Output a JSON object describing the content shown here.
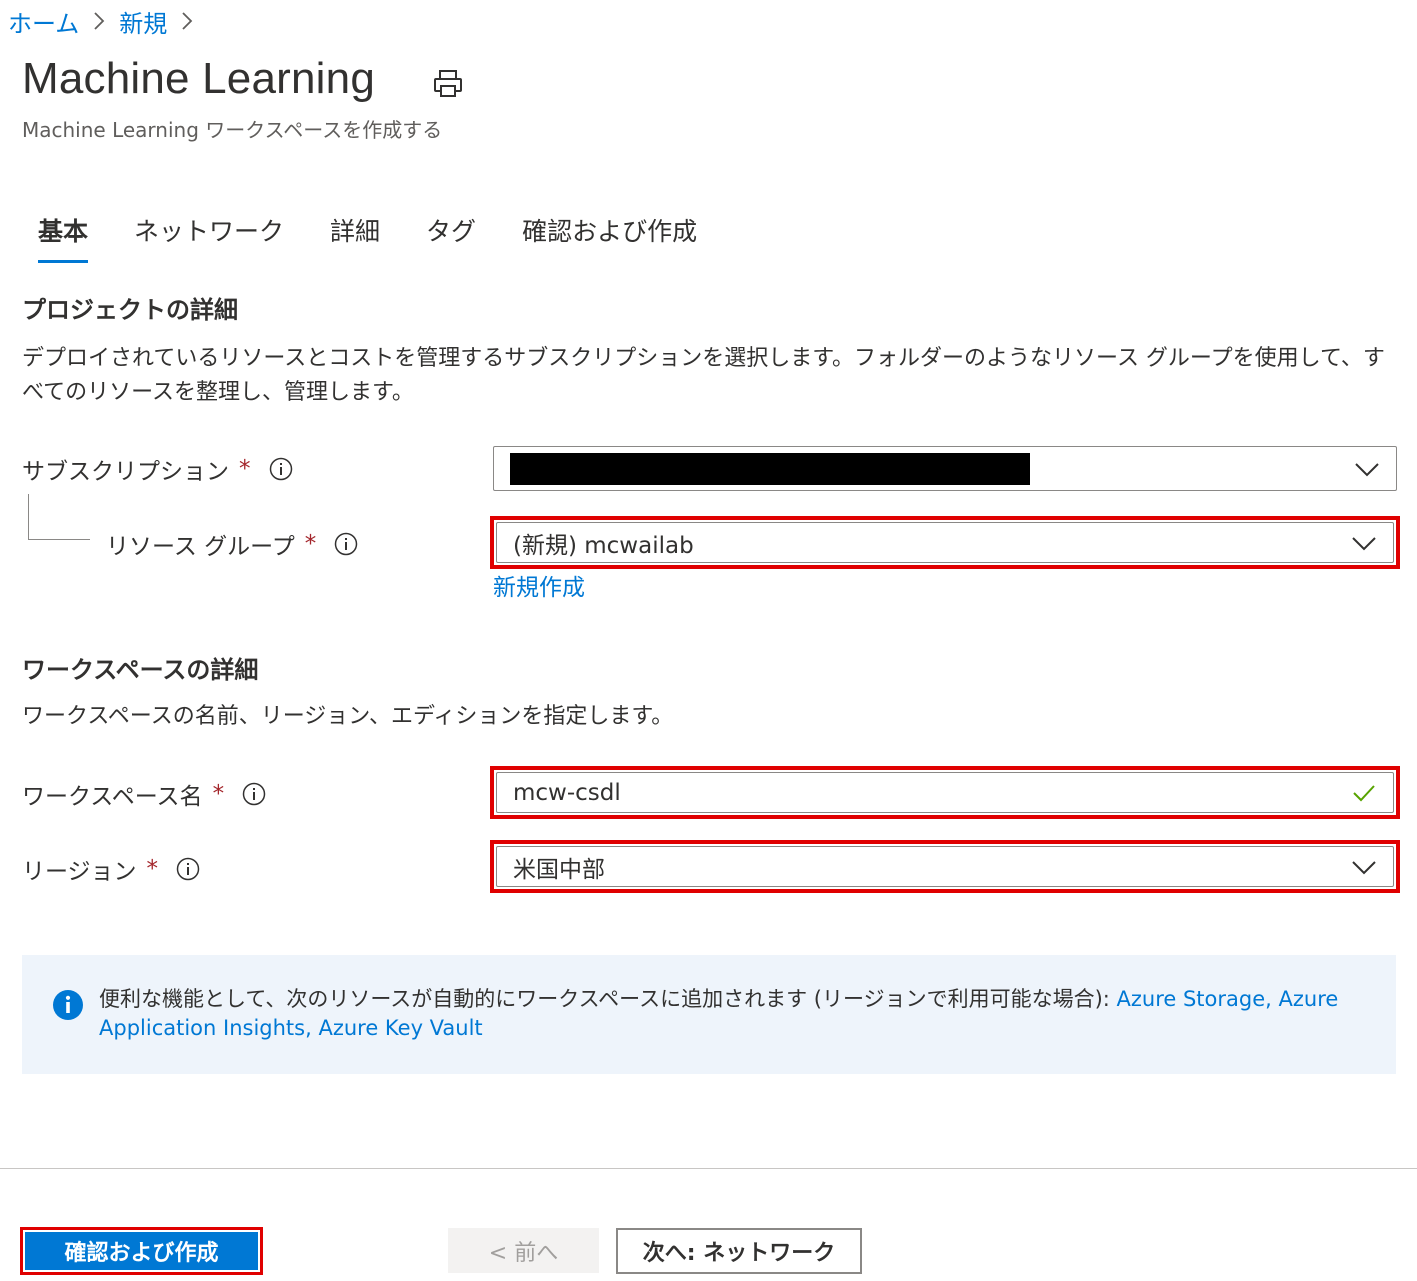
{
  "breadcrumb": {
    "items": [
      "ホーム",
      "新規"
    ]
  },
  "header": {
    "title": "Machine Learning",
    "subtitle": "Machine Learning ワークスペースを作成する",
    "print_icon": "print-icon"
  },
  "tabs": [
    {
      "label": "基本",
      "active": true
    },
    {
      "label": "ネットワーク",
      "active": false
    },
    {
      "label": "詳細",
      "active": false
    },
    {
      "label": "タグ",
      "active": false
    },
    {
      "label": "確認および作成",
      "active": false
    }
  ],
  "project": {
    "heading": "プロジェクトの詳細",
    "description": "デプロイされているリソースとコストを管理するサブスクリプションを選択します。フォルダーのようなリソース グループを使用して、すべてのリソースを整理し、管理します。",
    "subscription_label": "サブスクリプション",
    "subscription_value": "",
    "resource_group_label": "リソース グループ",
    "resource_group_value": "(新規) mcwailab",
    "create_new_link": "新規作成",
    "required_mark": "*"
  },
  "workspace": {
    "heading": "ワークスペースの詳細",
    "description": "ワークスペースの名前、リージョン、エディションを指定します。",
    "name_label": "ワークスペース名",
    "name_value": "mcw-csdl",
    "region_label": "リージョン",
    "region_value": "米国中部",
    "required_mark": "*"
  },
  "info": {
    "text": "便利な機能として、次のリソースが自動的にワークスペースに追加されます (リージョンで利用可能な場合): ",
    "links": "Azure Storage, Azure Application Insights, Azure Key Vault"
  },
  "footer": {
    "review_create": "確認および作成",
    "previous": "< 前へ",
    "next": "次へ: ネットワーク"
  },
  "colors": {
    "accent": "#0078d4",
    "highlight": "#e00000",
    "valid": "#57a300",
    "required": "#a4262c"
  }
}
